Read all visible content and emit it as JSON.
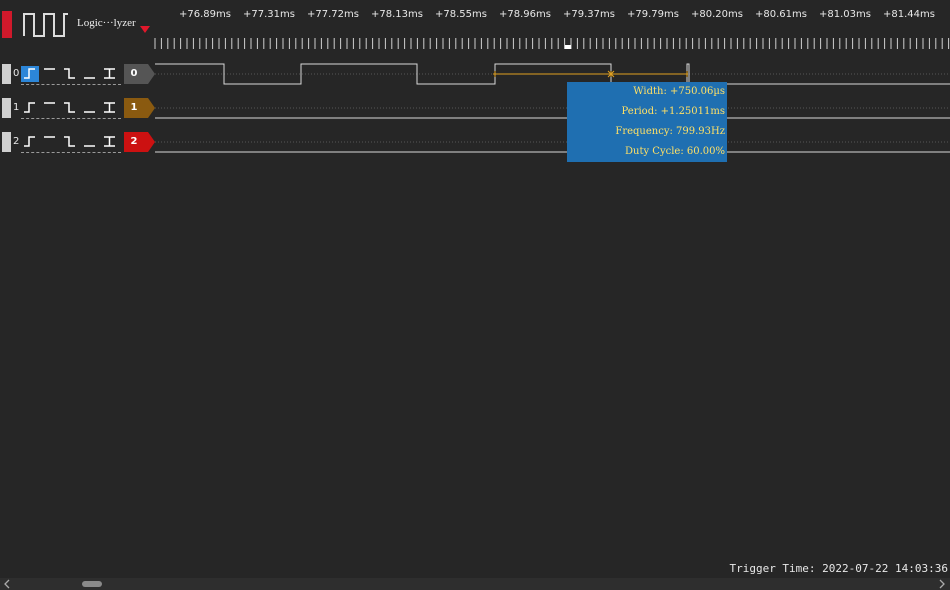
{
  "app": {
    "title": "Logic···lyzer"
  },
  "timeline": {
    "ticks": [
      "+76.89ms",
      "+77.31ms",
      "+77.72ms",
      "+78.13ms",
      "+78.55ms",
      "+78.96ms",
      "+79.37ms",
      "+79.79ms",
      "+80.20ms",
      "+80.61ms",
      "+81.03ms",
      "+81.44ms"
    ]
  },
  "channels": [
    {
      "index": "0",
      "badge": "0",
      "color": "#555555",
      "selected_trigger": "rising-edge"
    },
    {
      "index": "1",
      "badge": "1",
      "color": "#8a5a10",
      "selected_trigger": "none"
    },
    {
      "index": "2",
      "badge": "2",
      "color": "#cc1111",
      "selected_trigger": "none"
    }
  ],
  "trigger_options": [
    "rising-edge",
    "high",
    "falling-edge",
    "low",
    "any-edge"
  ],
  "measurement": {
    "width": "Width: +750.06µs",
    "period": "Period: +1.25011ms",
    "frequency": "Frequency: 799.93Hz",
    "duty": "Duty Cycle: 60.00%"
  },
  "status": {
    "trigger_time": "Trigger Time: 2022-07-22 14:03:36"
  },
  "colors": {
    "accent_red": "#cc1111",
    "measure_bg": "#1f6fb1",
    "measure_text": "#ffe066",
    "trigger_selected": "#2c86d8"
  }
}
